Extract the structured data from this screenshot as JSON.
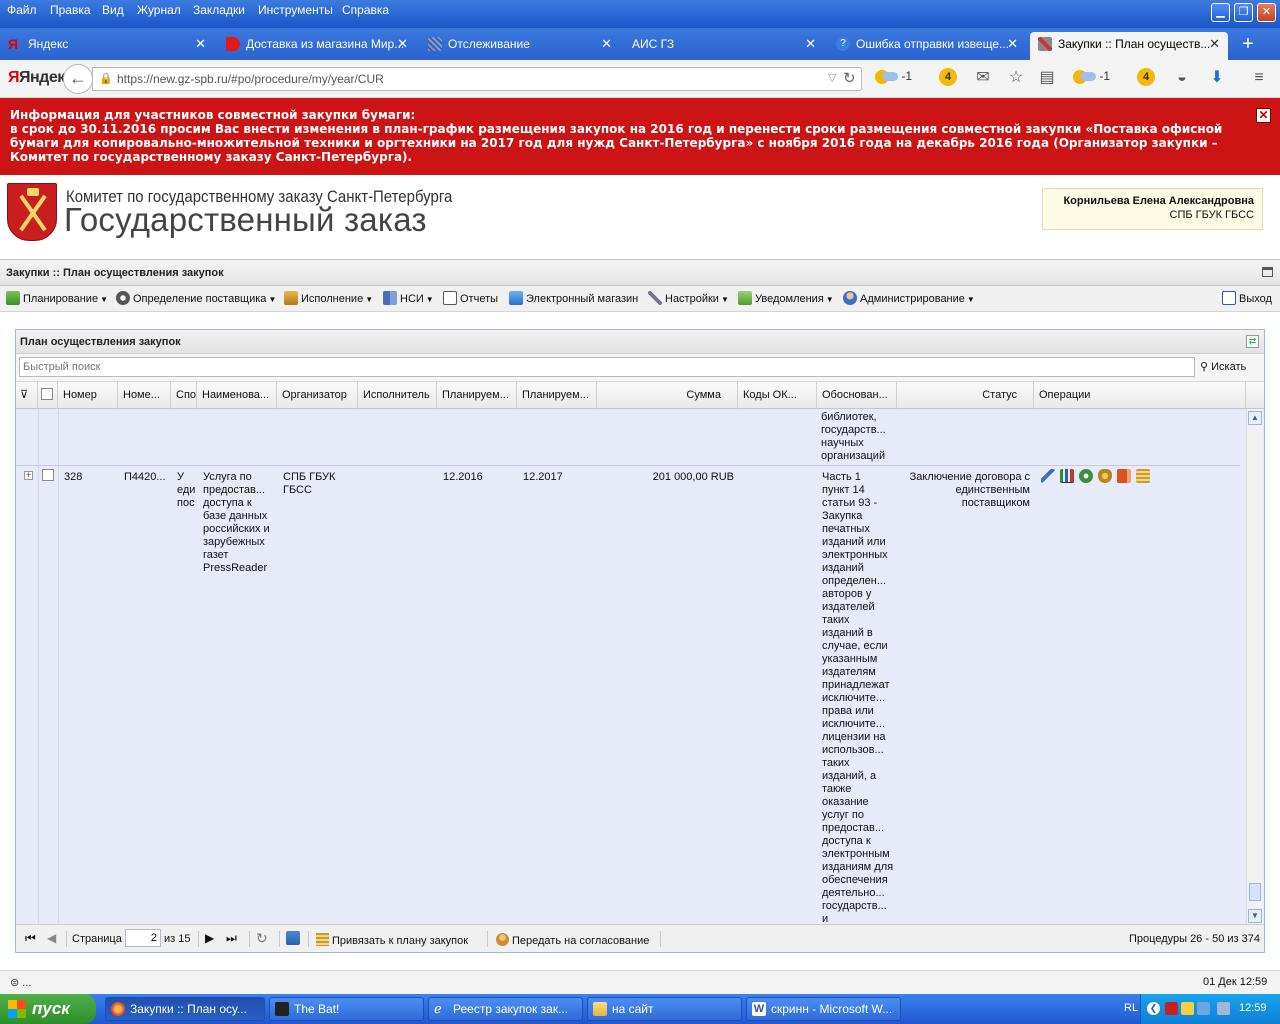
{
  "menubar": {
    "items": [
      "Файл",
      "Правка",
      "Вид",
      "Журнал",
      "Закладки",
      "Инструменты",
      "Справка"
    ]
  },
  "tabs": [
    {
      "label": "Яндекс",
      "icon": "yandex-icon"
    },
    {
      "label": "Доставка из магазина Мир...",
      "icon": "arrow-icon"
    },
    {
      "label": "Отслеживание",
      "icon": "tracking-icon"
    },
    {
      "label": "АИС ГЗ",
      "icon": "page-icon"
    },
    {
      "label": "Ошибка отправки извеще...",
      "icon": "help-icon"
    },
    {
      "label": "Закупки :: План осуществ...",
      "icon": "tools-icon",
      "active": true
    }
  ],
  "navbar": {
    "yandex_logo": "Яндекс",
    "url": "https://new.gz-spb.ru/#po/procedure/my/year/CUR",
    "weather1": "-1",
    "weather2": "-1",
    "badge1": "4",
    "badge2": "4"
  },
  "banner": {
    "lines": [
      "Информация для участников совместной закупки бумаги:",
      "в срок до 30.11.2016 просим Вас внести изменения в план-график размещения закупок на 2016 год и перенести сроки размещения совместной закупки «Поставка офисной",
      "бумаги для копировально-множительной техники и оргтехники на 2017 год для нужд Санкт-Петербурга» с ноября 2016 года на декабрь 2016 года (Организатор закупки –",
      "Комитет по государственному заказу Санкт-Петербурга)."
    ]
  },
  "site": {
    "org": "Комитет по государственному заказу Санкт-Петербурга",
    "title": "Государственный заказ",
    "user_name": "Корнильева Елена Александровна",
    "user_org": "СПБ ГБУК ГБСС"
  },
  "app": {
    "title": "Закупки :: План осуществления закупок",
    "toolbar": {
      "planning": "Планирование",
      "supplier": "Определение поставщика",
      "execution": "Исполнение",
      "nsi": "НСИ",
      "reports": "Отчеты",
      "eshop": "Электронный магазин",
      "settings": "Настройки",
      "notifications": "Уведомления",
      "admin": "Администрирование",
      "exit": "Выход"
    }
  },
  "grid": {
    "title": "План осуществления закупок",
    "search_placeholder": "Быстрый поиск",
    "search_btn": "Искать",
    "columns": {
      "number": "Номер",
      "number2": "Номе...",
      "method": "Спо",
      "name": "Наименова...",
      "organizer": "Организатор",
      "executor": "Исполнитель",
      "planned1": "Планируем...",
      "planned2": "Планируем...",
      "sum": "Сумма",
      "okpd": "Коды ОК...",
      "justification": "Обоснован...",
      "status": "Статус",
      "operations": "Операции"
    },
    "prev_row_justification": [
      "библиотек,",
      "государств...",
      "научных",
      "организаций"
    ],
    "row": {
      "number": "328",
      "number2": "П4420...",
      "method": [
        "У",
        "еди",
        "пос"
      ],
      "name": [
        "Услуга по",
        "предостав...",
        "доступа к",
        "базе данных",
        "российских и",
        "зарубежных",
        "газет",
        "PressReader"
      ],
      "organizer": [
        "СПБ ГБУК",
        "ГБСС"
      ],
      "planned1": "12.2016",
      "planned2": "12.2017",
      "sum": "201 000,00 RUB",
      "justification": [
        "Часть 1",
        "пункт 14",
        "статьи 93 -",
        "Закупка",
        "печатных",
        "изданий или",
        "электронных",
        "изданий",
        "определен...",
        "авторов у",
        "издателей",
        "таких",
        "изданий в",
        "случае, если",
        "указанным",
        "издателям",
        "принадлежат",
        "исключите...",
        "права или",
        "исключите...",
        "лицензии на",
        "использов...",
        "таких",
        "изданий, а",
        "также",
        "оказание",
        "услуг по",
        "предостав...",
        "доступа к",
        "электронным",
        "изданиям для",
        "обеспечения",
        "деятельно...",
        "государств...",
        "и"
      ],
      "status": [
        "Заключение договора с",
        "единственным",
        "поставщиком"
      ],
      "operations": [
        "edit-icon",
        "chart-icon",
        "gear-icon",
        "emblem-icon",
        "book-icon",
        "scroll-icon"
      ]
    },
    "pager": {
      "page_label": "Страница",
      "page_value": "2",
      "of_label": "из 15",
      "bind_plan": "Привязать к плану закупок",
      "send_approval": "Передать на согласование",
      "summary": "Процедуры 26 - 50 из 374"
    }
  },
  "statusbar": {
    "left": "⊜ ...",
    "right": "01 Дек 12:59"
  },
  "taskbar": {
    "start": "пуск",
    "tasks": [
      "Закупки :: План осу...",
      "The Bat!",
      "Реестр закупок зак...",
      "на сайт",
      "скринн - Microsoft W..."
    ],
    "lang": "RL",
    "clock": "12:59"
  }
}
